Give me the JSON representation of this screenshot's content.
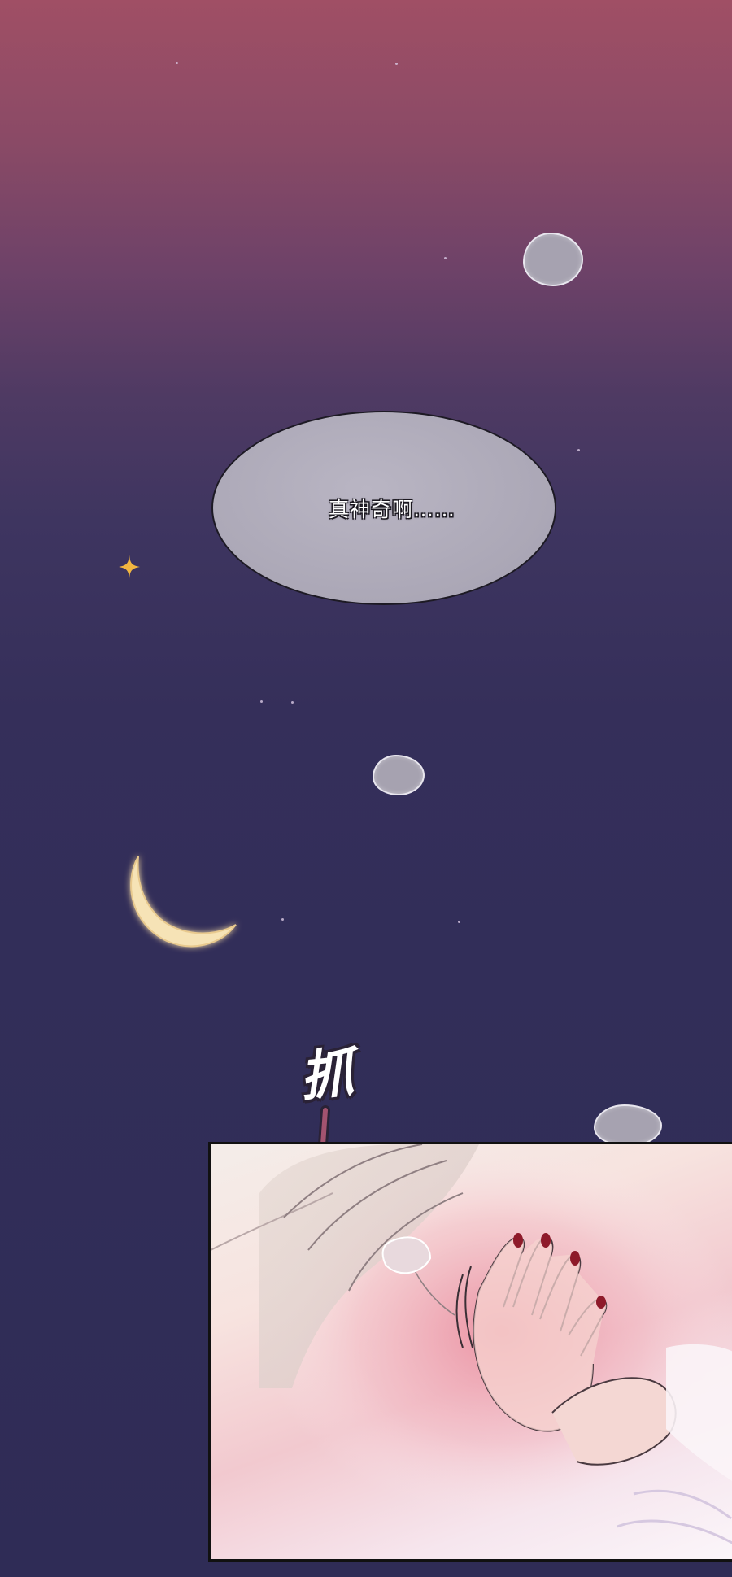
{
  "speech_bubble": {
    "text": "真神奇啊……"
  },
  "sound_effect": {
    "text": "抓"
  },
  "colors": {
    "sky_top": "#a04f65",
    "sky_mid": "#3e3560",
    "sky_bottom": "#2f2c56",
    "moon": "#f6e3b6",
    "sparkle": "#f2b640",
    "bubble_fill": "#aba7b6",
    "nail_polish": "#8e1a2a"
  },
  "icons": {
    "moon": "crescent-moon-icon",
    "sparkle": "four-point-star-icon",
    "cloud": "cloud-icon"
  }
}
